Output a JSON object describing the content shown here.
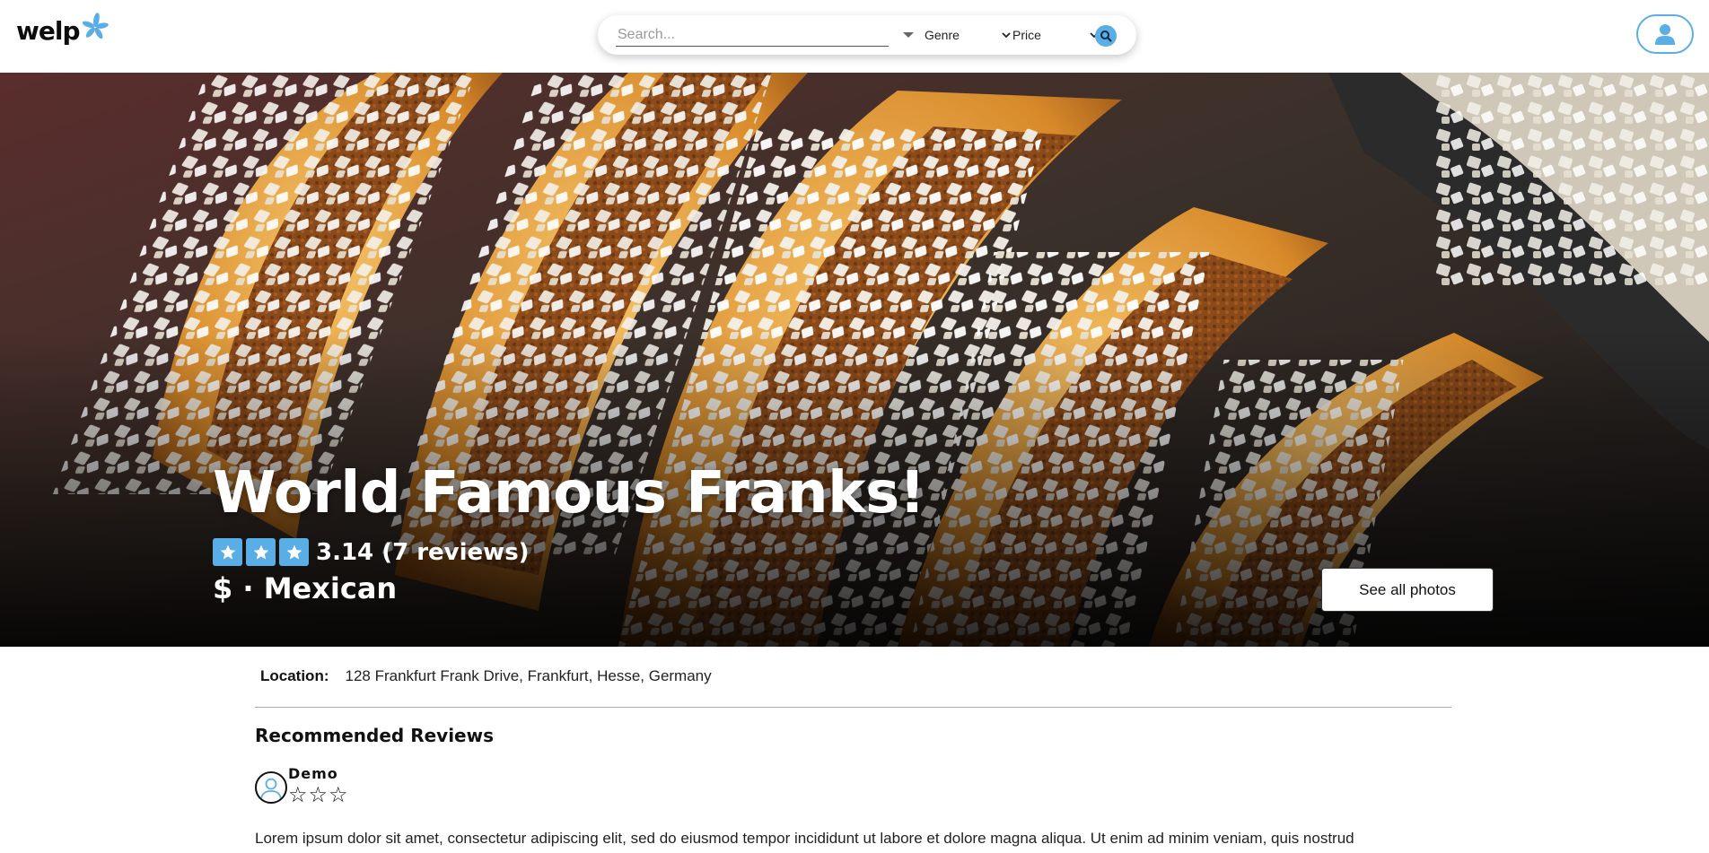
{
  "header": {
    "logo_text": "welp",
    "search": {
      "placeholder": "Search...",
      "value": ""
    },
    "genre_select": {
      "label": "Genre"
    },
    "price_select": {
      "label": "Price"
    }
  },
  "restaurant": {
    "name": "World Famous Franks!",
    "rating": {
      "stars_filled": 3,
      "text": "3.14 (7 reviews)"
    },
    "price_genre": "$ · Mexican",
    "see_photos_label": "See all photos",
    "location_label": "Location:",
    "location_value": "128 Frankfurt Frank Drive, Frankfurt, Hesse, Germany"
  },
  "reviews": {
    "heading": "Recommended Reviews",
    "items": [
      {
        "author": "Demo",
        "stars": [
          "☆",
          "☆",
          "☆"
        ],
        "text": "Lorem ipsum dolor sit amet, consectetur adipiscing elit, sed do eiusmod tempor incididunt ut labore et dolore magna aliqua. Ut enim ad minim veniam, quis nostrud"
      }
    ]
  },
  "colors": {
    "accent": "#5aaee6",
    "text": "#111111"
  }
}
